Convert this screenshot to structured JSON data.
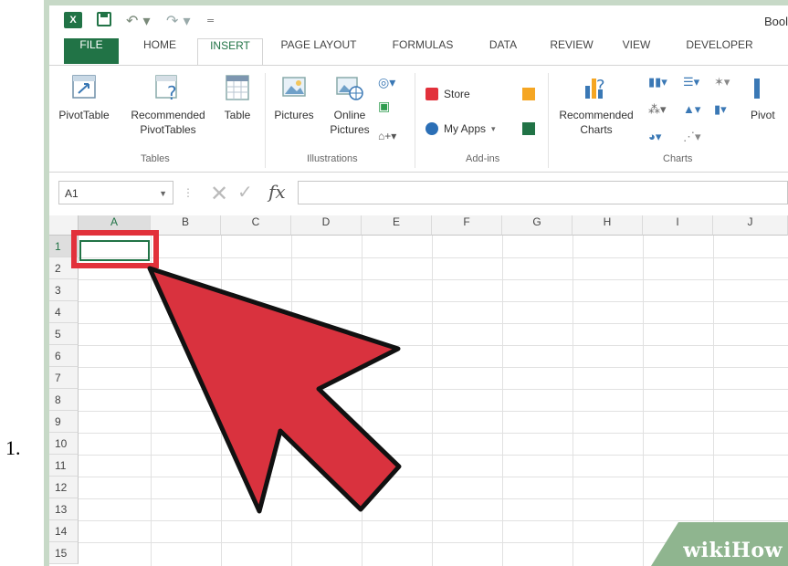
{
  "list_number": "1.",
  "title_bar": {
    "doc_title": "Bool",
    "logo_text": "X",
    "qat_more": "="
  },
  "tabs": [
    {
      "label": "FILE"
    },
    {
      "label": "HOME"
    },
    {
      "label": "INSERT"
    },
    {
      "label": "PAGE LAYOUT"
    },
    {
      "label": "FORMULAS"
    },
    {
      "label": "DATA"
    },
    {
      "label": "REVIEW"
    },
    {
      "label": "VIEW"
    },
    {
      "label": "DEVELOPER"
    }
  ],
  "ribbon": {
    "tables": {
      "label": "Tables",
      "pivot_table": "PivotTable",
      "recommended_pivot_1": "Recommended",
      "recommended_pivot_2": "PivotTables",
      "table": "Table"
    },
    "illustrations": {
      "label": "Illustrations",
      "pictures": "Pictures",
      "online_pictures_1": "Online",
      "online_pictures_2": "Pictures"
    },
    "addins": {
      "label": "Add-ins",
      "store": "Store",
      "my_apps": "My Apps"
    },
    "charts": {
      "label": "Charts",
      "recommended_1": "Recommended",
      "recommended_2": "Charts",
      "pivot_partial": "Pivot"
    }
  },
  "formula_bar": {
    "name_box": "A1",
    "fx": "fx",
    "value": ""
  },
  "columns": [
    "A",
    "B",
    "C",
    "D",
    "E",
    "F",
    "G",
    "H",
    "I",
    "J"
  ],
  "rows": [
    "1",
    "2",
    "3",
    "4",
    "5",
    "6",
    "7",
    "8",
    "9",
    "10",
    "11",
    "12",
    "13",
    "14",
    "15"
  ],
  "watermark": {
    "wiki": "wiki",
    "how": "How"
  },
  "colors": {
    "excel_green": "#217346",
    "highlight_red": "#e2313b",
    "watermark_green": "#8fb58f"
  }
}
